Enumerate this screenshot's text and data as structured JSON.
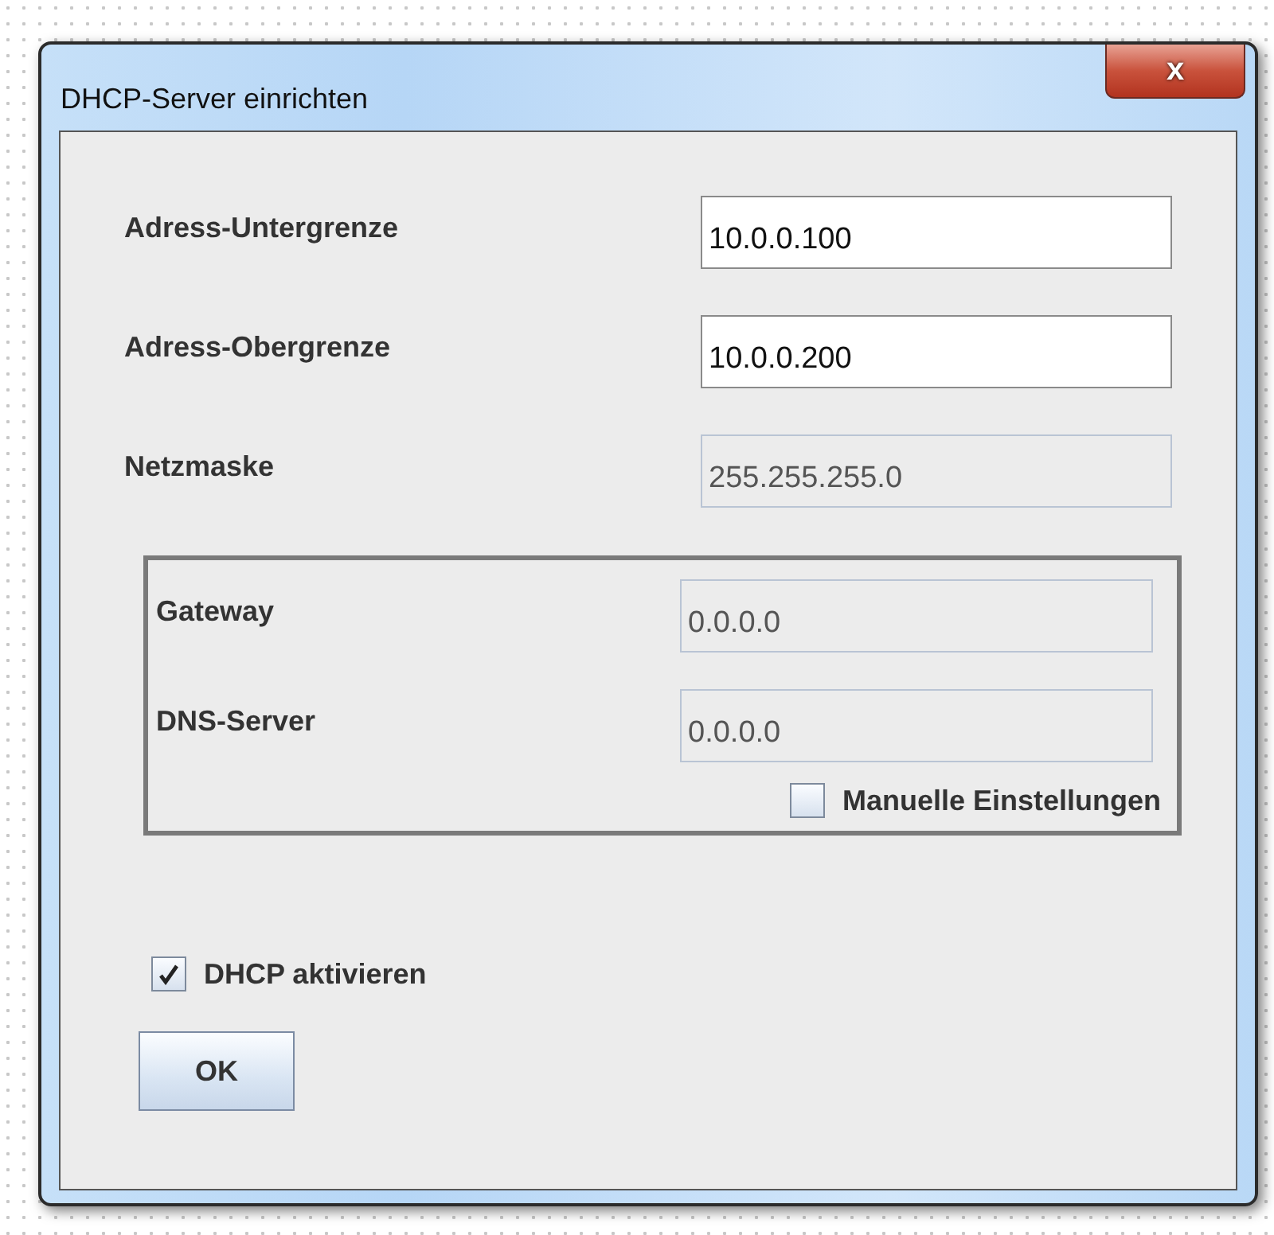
{
  "window": {
    "title": "DHCP-Server einrichten",
    "close": "x"
  },
  "fields": [
    {
      "label": "Adress-Untergrenze",
      "value": "10.0.0.100",
      "disabled": false
    },
    {
      "label": "Adress-Obergrenze",
      "value": "10.0.0.200",
      "disabled": false
    },
    {
      "label": "Netzmaske",
      "value": "255.255.255.0",
      "disabled": true
    }
  ],
  "group": {
    "fields": [
      {
        "label": "Gateway",
        "value": "0.0.0.0",
        "disabled": true
      },
      {
        "label": "DNS-Server",
        "value": "0.0.0.0",
        "disabled": true
      }
    ],
    "checkbox": {
      "label": "Manuelle Einstellungen",
      "checked": false
    }
  },
  "checkbox": {
    "label": "DHCP aktivieren",
    "checked": true
  },
  "buttons": [
    "OK"
  ]
}
